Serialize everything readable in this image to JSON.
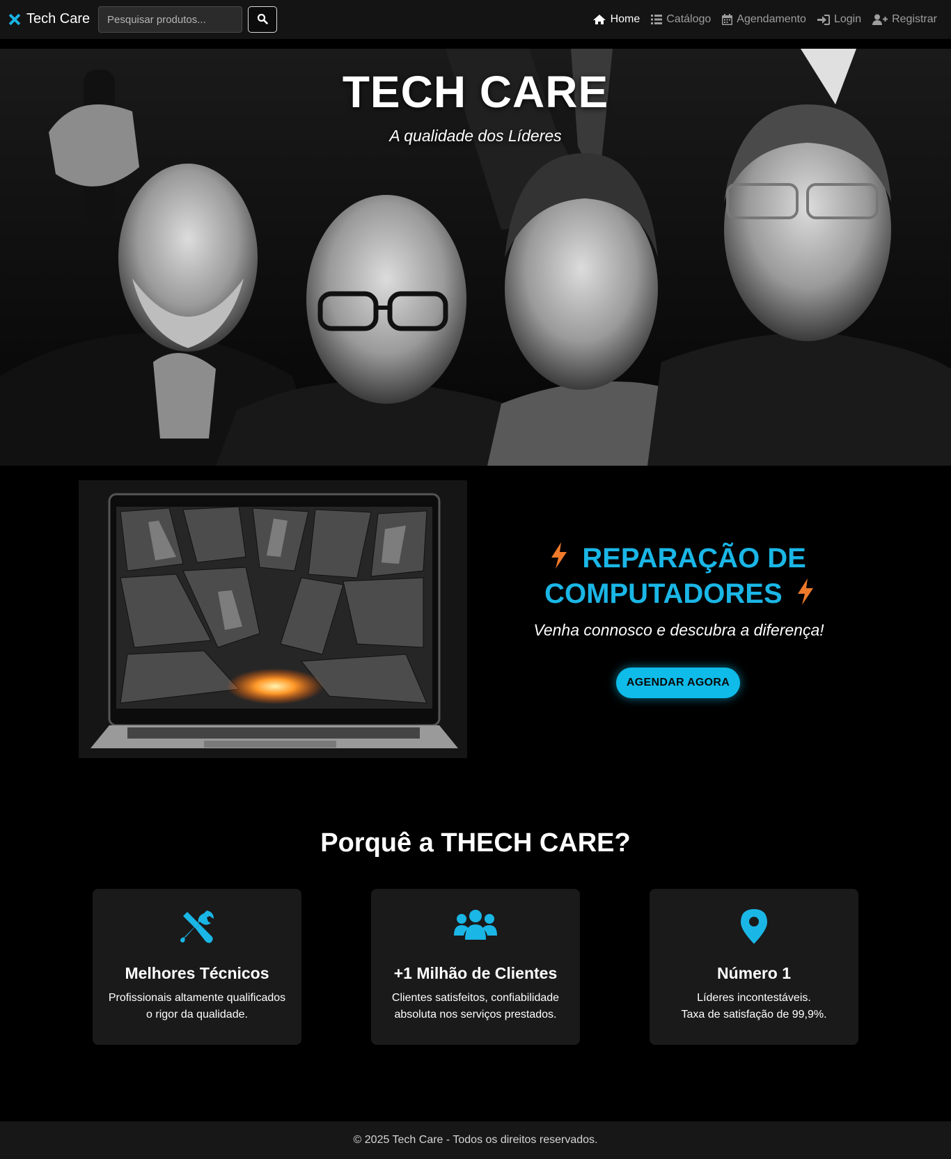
{
  "navbar": {
    "brand": "Tech Care",
    "search_placeholder": "Pesquisar produtos...",
    "links": [
      {
        "label": "Home",
        "icon": "home-icon",
        "active": true
      },
      {
        "label": "Catálogo",
        "icon": "list-icon"
      },
      {
        "label": "Agendamento",
        "icon": "calendar-icon"
      },
      {
        "label": "Login",
        "icon": "sign-in-icon"
      },
      {
        "label": "Registrar",
        "icon": "user-plus-icon"
      }
    ]
  },
  "hero": {
    "title": "TECH CARE",
    "subtitle": "A qualidade dos Líderes"
  },
  "promo": {
    "heading_line1": "REPARAÇÃO DE",
    "heading_line2": "COMPUTADORES",
    "tagline": "Venha connosco e descubra a diferença!",
    "cta": "AGENDAR AGORA"
  },
  "why": {
    "title": "Porquê a THECH CARE?",
    "cards": [
      {
        "icon": "tools-icon",
        "title": "Melhores Técnicos",
        "line1": "Profissionais altamente qualificados",
        "line2": "o rigor da qualidade."
      },
      {
        "icon": "users-icon",
        "title": "+1 Milhão de Clientes",
        "line1": "Clientes satisfeitos, confiabilidade",
        "line2": "absoluta nos serviços prestados."
      },
      {
        "icon": "map-marker-icon",
        "title": "Número 1",
        "line1": "Líderes incontestáveis.",
        "line2": "Taxa de satisfação de 99,9%."
      }
    ]
  },
  "footer": {
    "text": "© 2025 Tech Care - Todos os direitos reservados."
  },
  "colors": {
    "accent": "#1ab6e6",
    "bolt": "#f07a2a",
    "navbar_bg": "#141414",
    "card_bg": "#1a1a1a"
  }
}
